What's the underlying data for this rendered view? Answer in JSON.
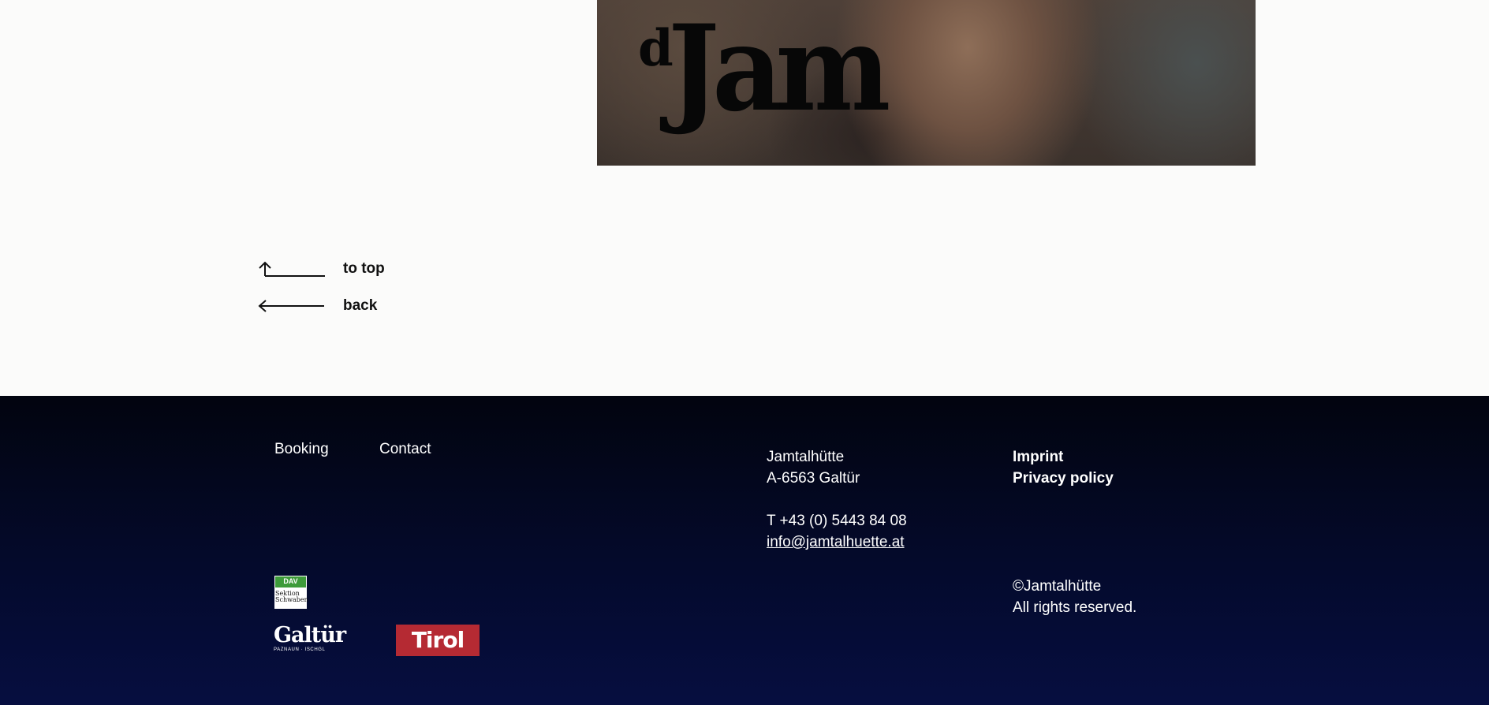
{
  "hero": {
    "title_small": "d",
    "title_big": "Jam"
  },
  "nav": {
    "to_top_label": "to top",
    "back_label": "back"
  },
  "footer": {
    "links": {
      "booking": "Booking",
      "contact": "Contact"
    },
    "address": {
      "name": "Jamtalhütte",
      "city": "A-6563 Galtür",
      "phone": "T +43 (0)  5443 84 08",
      "email": "info@jamtalhuette.at"
    },
    "legal": {
      "imprint": "Imprint",
      "privacy": "Privacy policy"
    },
    "copyright": {
      "owner": "©Jamtalhütte",
      "rights": "All rights reserved."
    },
    "logos": {
      "dav_text": "DAV",
      "dav_sub_1": "Sektion",
      "dav_sub_2": "Schwaben",
      "galtur_text": "Galtür",
      "galtur_sub": "PAZNAUN · ISCHGL",
      "tirol_text": "Tirol"
    }
  },
  "colors": {
    "page_bg": "#fbfbfa",
    "footer_bg_top": "#02040f",
    "footer_bg_bottom": "#060e40",
    "tirol_red": "#b52a33",
    "dav_green": "#3e9b3a"
  }
}
